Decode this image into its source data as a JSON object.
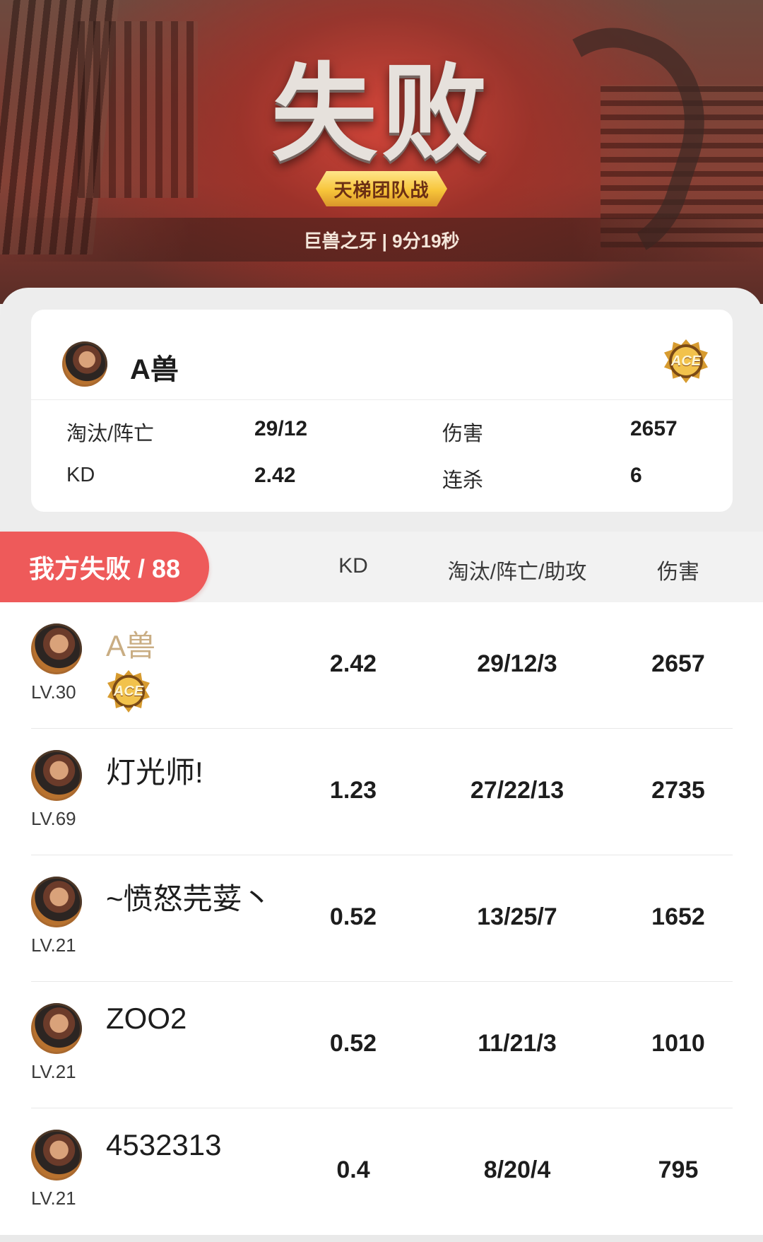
{
  "header": {
    "result_title": "失败",
    "mode": "天梯团队战",
    "match_info": "巨兽之牙 | 9分19秒"
  },
  "player_card": {
    "name": "A兽",
    "badge": "ACE",
    "stats": {
      "kd_label": "淘汰/阵亡",
      "kd_value": "29/12",
      "damage_label": "伤害",
      "damage_value": "2657",
      "ratio_label": "KD",
      "ratio_value": "2.42",
      "streak_label": "连杀",
      "streak_value": "6"
    }
  },
  "team": {
    "result_label": "我方失败 / 88",
    "columns": [
      "KD",
      "淘汰/阵亡/助攻",
      "伤害"
    ]
  },
  "players": [
    {
      "name": "A兽",
      "level": "LV.30",
      "kd": "2.42",
      "kda": "29/12/3",
      "damage": "2657",
      "badge": "ACE"
    },
    {
      "name": "灯光师!",
      "level": "LV.69",
      "kd": "1.23",
      "kda": "27/22/13",
      "damage": "2735"
    },
    {
      "name": "~愤怒芫荽丶",
      "level": "LV.21",
      "kd": "0.52",
      "kda": "13/25/7",
      "damage": "1652"
    },
    {
      "name": "ZOO2",
      "level": "LV.21",
      "kd": "0.52",
      "kda": "11/21/3",
      "damage": "1010"
    },
    {
      "name": "4532313",
      "level": "LV.21",
      "kd": "0.4",
      "kda": "8/20/4",
      "damage": "795"
    }
  ],
  "colors": {
    "accent_red": "#ee5a5a",
    "hero_red": "#c2423a",
    "self_name": "#c9ad83",
    "badge_gold": "#f7c53a"
  }
}
